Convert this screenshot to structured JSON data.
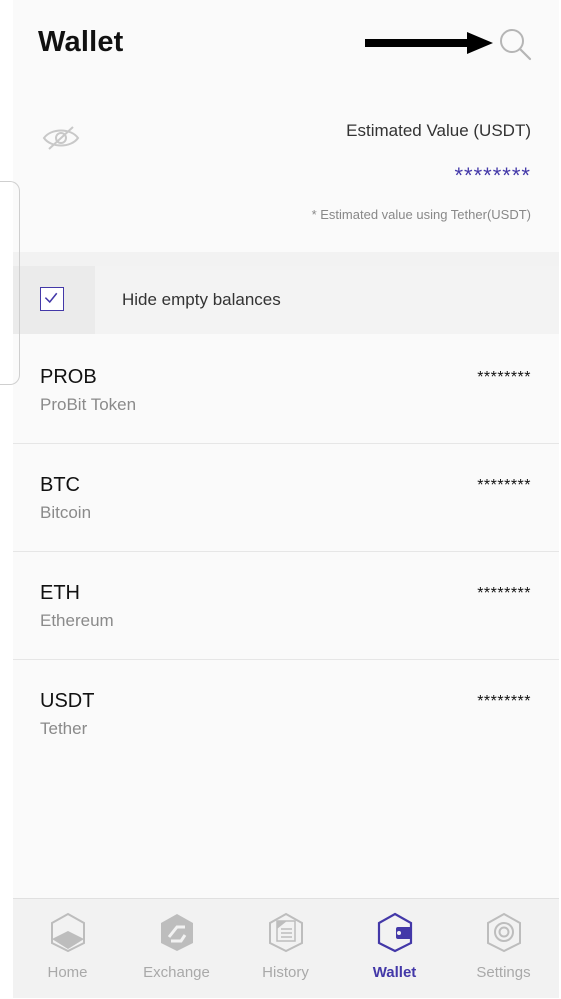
{
  "header": {
    "title": "Wallet",
    "search_icon": "search-icon",
    "arrow": "arrow-right-annotation"
  },
  "summary": {
    "eye_icon": "eye-slash-icon",
    "estimated_label": "Estimated Value (USDT)",
    "estimated_value": "********",
    "note": "* Estimated value using Tether(USDT)"
  },
  "filter": {
    "label": "Hide empty balances",
    "checked": true
  },
  "coins": [
    {
      "symbol": "PROB",
      "name": "ProBit Token",
      "balance": "********"
    },
    {
      "symbol": "BTC",
      "name": "Bitcoin",
      "balance": "********"
    },
    {
      "symbol": "ETH",
      "name": "Ethereum",
      "balance": "********"
    },
    {
      "symbol": "USDT",
      "name": "Tether",
      "balance": "********"
    }
  ],
  "tabs": [
    {
      "label": "Home",
      "icon": "home-icon"
    },
    {
      "label": "Exchange",
      "icon": "exchange-icon"
    },
    {
      "label": "History",
      "icon": "history-icon"
    },
    {
      "label": "Wallet",
      "icon": "wallet-icon",
      "active": true
    },
    {
      "label": "Settings",
      "icon": "settings-icon"
    }
  ],
  "colors": {
    "accent": "#4338a8",
    "inactive": "#a9a9a9"
  }
}
